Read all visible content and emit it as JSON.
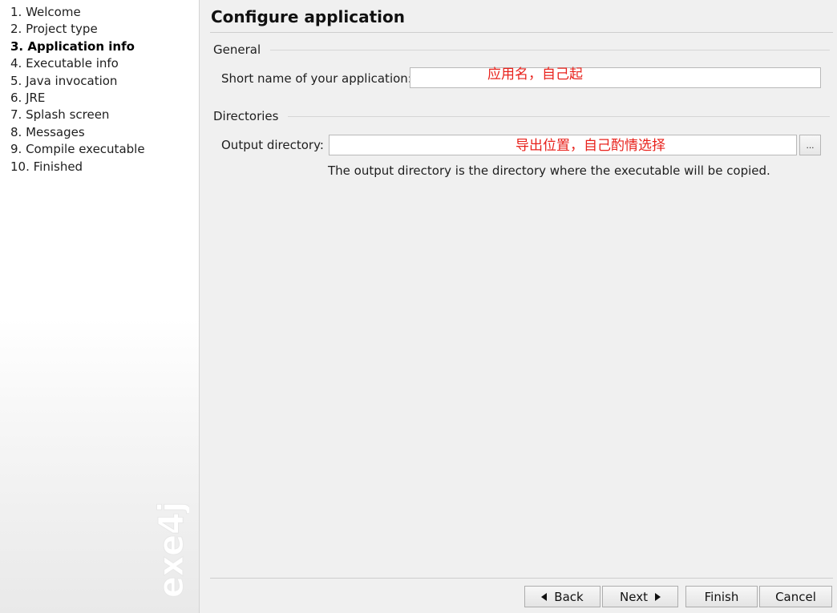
{
  "sidebar": {
    "steps": [
      "1. Welcome",
      "2. Project type",
      "3. Application info",
      "4. Executable info",
      "5. Java invocation",
      "6. JRE",
      "7. Splash screen",
      "8. Messages",
      "9. Compile executable",
      "10. Finished"
    ],
    "active_step": "3. Application info",
    "brand_text": "exe4j"
  },
  "main": {
    "title": "Configure application",
    "general": {
      "section_label": "General",
      "short_name_label": "Short name of your application:",
      "short_name_value": "",
      "short_name_annotation": "应用名，自己起"
    },
    "directories": {
      "section_label": "Directories",
      "output_dir_label": "Output directory:",
      "output_dir_value": "",
      "output_dir_annotation": "导出位置，自己酌情选择",
      "browse_label": "...",
      "hint": "The output directory is the directory where the executable will be copied."
    }
  },
  "footer": {
    "back_label": "Back",
    "next_label": "Next",
    "finish_label": "Finish",
    "cancel_label": "Cancel"
  },
  "colors": {
    "annotation": "#e8221c",
    "background": "#f0f0f0"
  }
}
